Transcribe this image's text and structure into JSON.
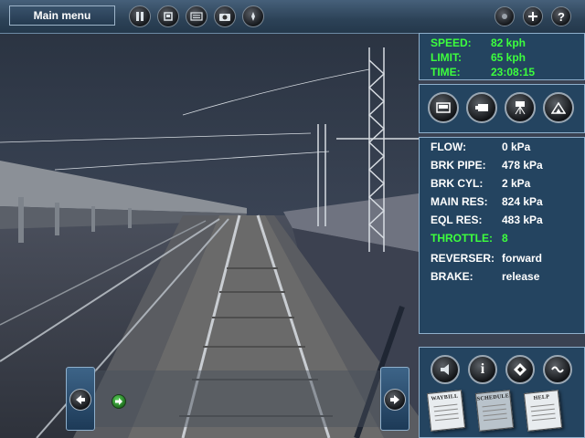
{
  "topbar": {
    "main_menu_label": "Main menu",
    "left_buttons": [
      "pause-icon",
      "stop-icon",
      "keyboard-icon",
      "camera-icon",
      "compass-icon"
    ],
    "right_buttons": [
      "dot-icon",
      "plus-icon",
      "help-icon"
    ]
  },
  "status": {
    "speed_label": "SPEED:",
    "speed_value": "82 kph",
    "limit_label": "LIMIT:",
    "limit_value": "65 kph",
    "time_label": "TIME:",
    "time_value": "23:08:15"
  },
  "cameras": [
    "cab-view-icon",
    "external-view-icon",
    "tripod-camera-icon",
    "trackside-view-icon"
  ],
  "info": [
    {
      "label": "FLOW:",
      "value": "0 kPa"
    },
    {
      "label": "BRK PIPE:",
      "value": "478 kPa"
    },
    {
      "label": "BRK CYL:",
      "value": "2 kPa"
    },
    {
      "label": "MAIN RES:",
      "value": "824 kPa"
    },
    {
      "label": "EQL RES:",
      "value": "483 kPa"
    },
    {
      "label": "THROTTLE:",
      "value": "8"
    },
    {
      "label": "REVERSER:",
      "value": "forward"
    },
    {
      "label": "BRAKE:",
      "value": "release"
    }
  ],
  "tools": {
    "icons": [
      "sound-icon",
      "info-icon",
      "switch-icon",
      "coupling-icon"
    ],
    "papers": [
      "WAYBILL",
      "SCHEDULE",
      "HELP"
    ]
  },
  "bottom_bar": {
    "icons": [
      "arrow-left-icon",
      "green-arrow-icon",
      "arrow-right-icon"
    ]
  },
  "colors": {
    "panel": "#244460",
    "status_green": "#3dff3d",
    "text": "#ffffff",
    "accent_border": "#8fb0cc"
  }
}
